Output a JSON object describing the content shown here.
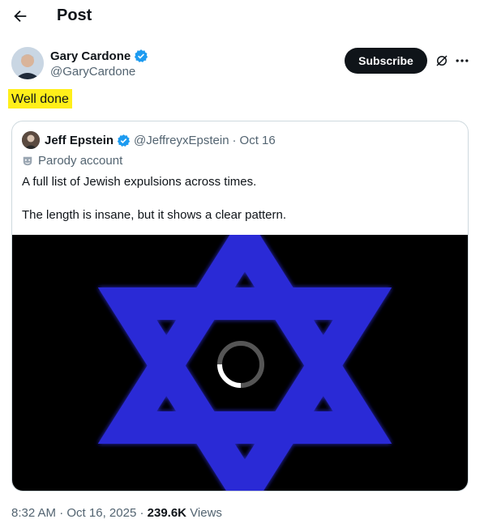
{
  "header": {
    "title": "Post"
  },
  "author": {
    "name": "Gary Cardone",
    "handle": "@GaryCardone"
  },
  "actions": {
    "subscribe_label": "Subscribe",
    "more_icon": "more-icon",
    "grok_icon": "grok-icon"
  },
  "tweet": {
    "text": "Well done"
  },
  "quote": {
    "name": "Jeff Epstein",
    "handle": "@JeffreyxEpstein",
    "separator": "·",
    "date": "Oct 16",
    "label": "Parody account",
    "line1": "A full list of Jewish expulsions across times.",
    "line2": "The length is insane, but it shows a clear pattern."
  },
  "meta": {
    "time": "8:32 AM",
    "sep": "·",
    "date": "Oct 16, 2025",
    "views_count": "239.6K",
    "views_label": "Views"
  },
  "colors": {
    "highlight": "#ffef1a",
    "verified": "#1d9bf0",
    "star": "#2b2bd6",
    "button_bg": "#0f1419"
  }
}
